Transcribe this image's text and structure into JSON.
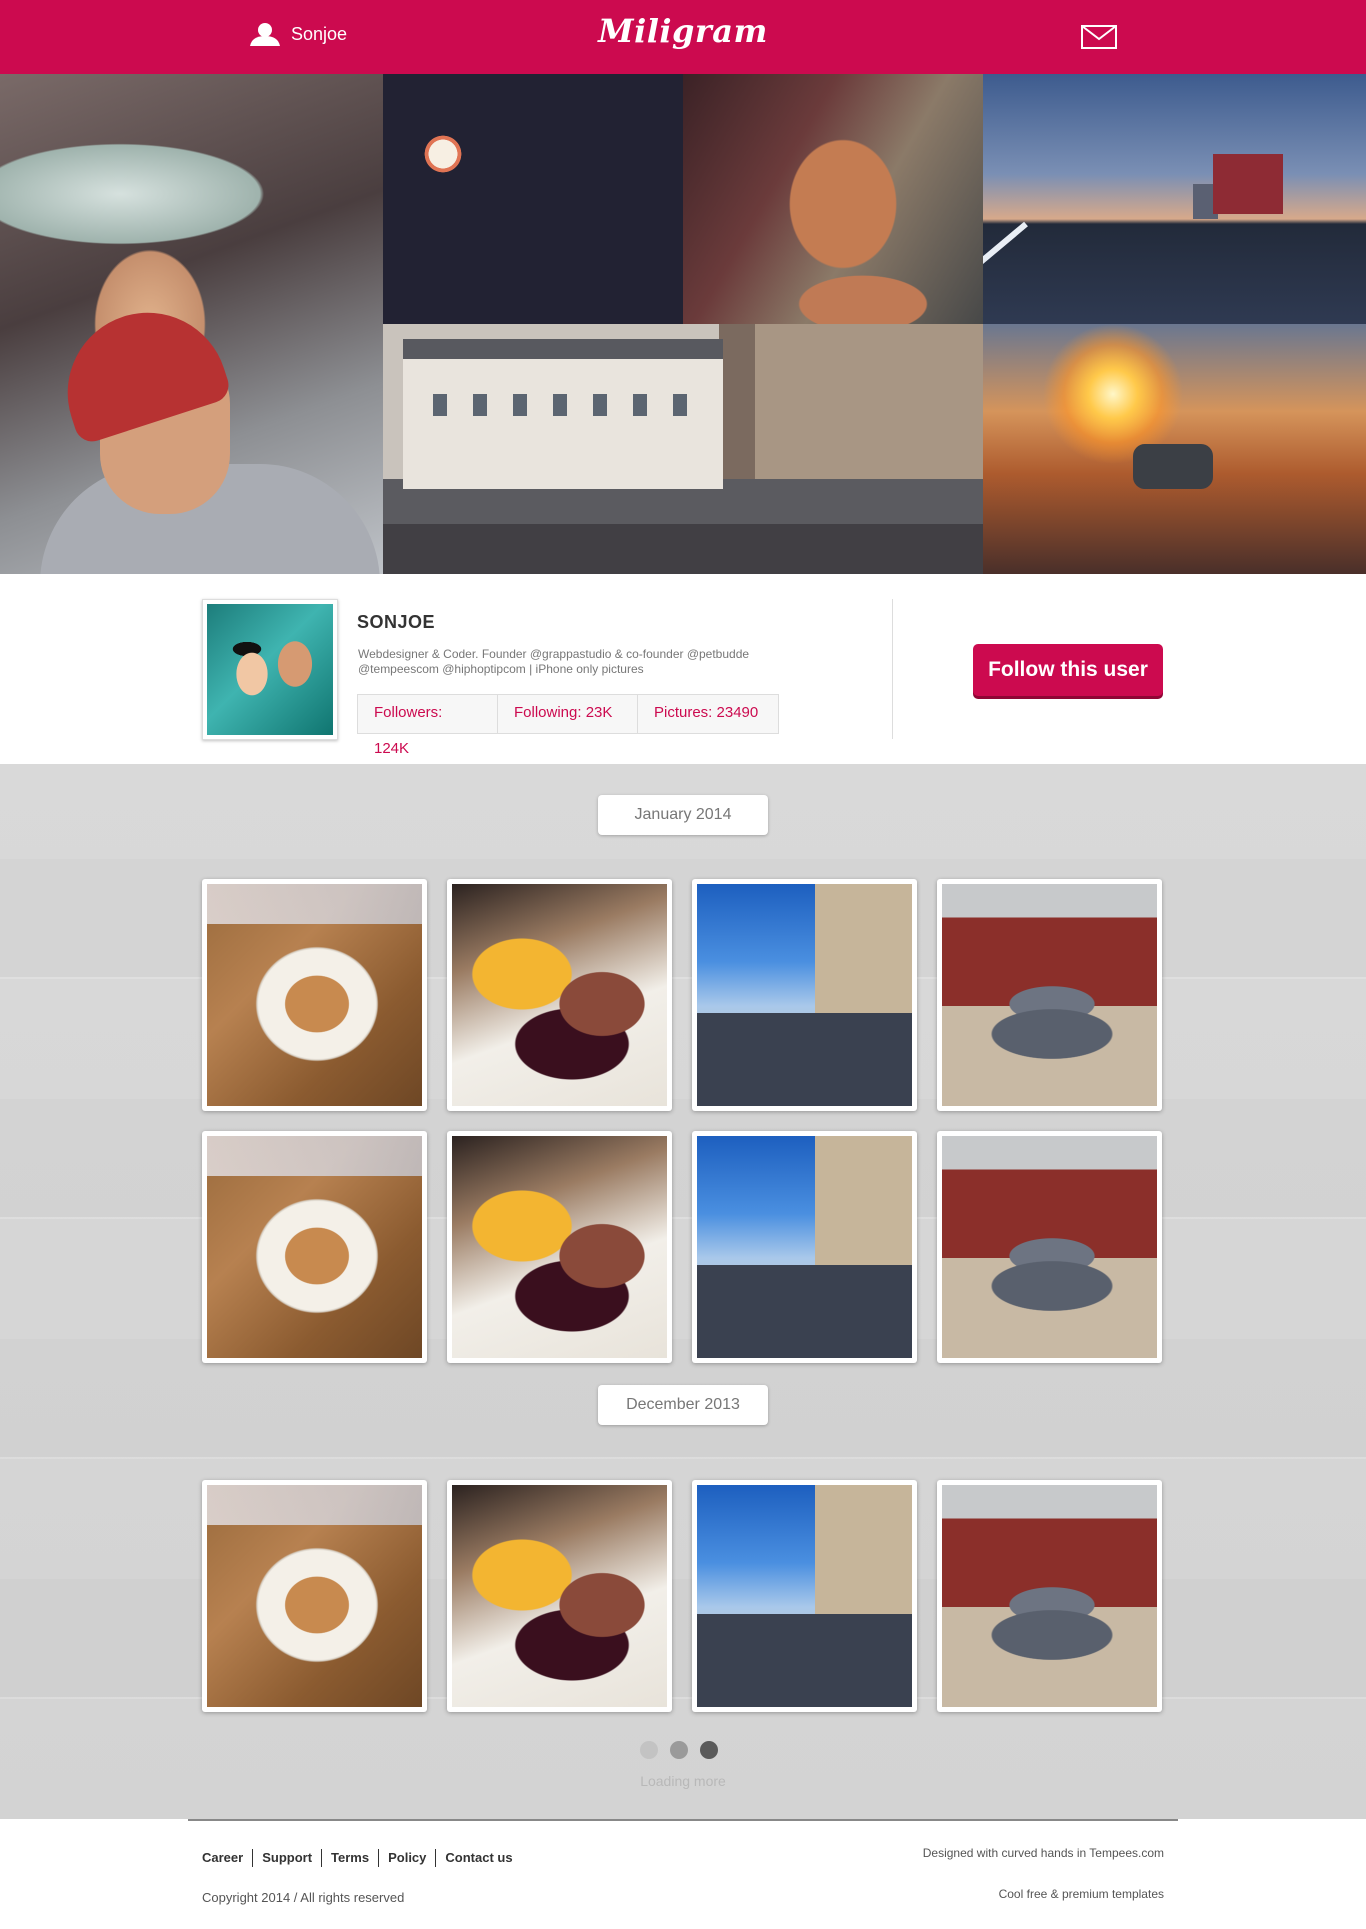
{
  "header": {
    "username": "Sonjoe",
    "logo": "Miligram",
    "brand_color": "#cc0a4f",
    "icons": {
      "user": "user-icon",
      "mail": "mail-icon"
    }
  },
  "profile": {
    "name": "SONJOE",
    "bio": "Webdesigner & Coder. Founder @grappastudio & co-founder @petbudde @tempeescom @hiphoptipcom | iPhone only pictures",
    "stats": [
      {
        "label": "Followers: 124K"
      },
      {
        "label": "Following: 23K"
      },
      {
        "label": "Pictures: 23490"
      }
    ],
    "follow_label": "Follow this user"
  },
  "feed": {
    "sections": [
      {
        "date": "January 2014"
      },
      {
        "date": "December 2013"
      }
    ],
    "loader_dot_colors": [
      "#c3c3c3",
      "#9a9a9a",
      "#5a5a5a"
    ],
    "loading_text": "Loading more"
  },
  "footer": {
    "links": [
      "Career",
      "Support",
      "Terms",
      "Policy",
      "Contact us"
    ],
    "copyright": "Copyright 2014 / All rights reserved",
    "designed": "Designed with curved hands in Tempees.com",
    "tagline": "Cool free & premium templates"
  }
}
